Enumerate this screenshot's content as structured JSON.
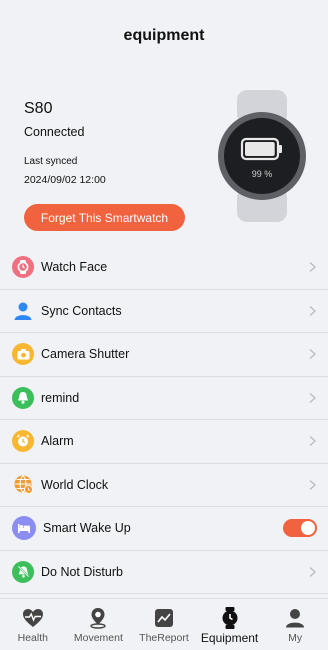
{
  "header": {
    "title": "equipment"
  },
  "device": {
    "name": "S80",
    "status": "Connected",
    "last_synced_label": "Last synced",
    "last_synced_time": "2024/09/02 12:00",
    "battery_text": "99 %",
    "battery_level": 0.99,
    "forget_label": "Forget This Smartwatch"
  },
  "menu": {
    "watch_face": "Watch Face",
    "sync_contacts": "Sync Contacts",
    "camera_shutter": "Camera Shutter",
    "remind": "remind",
    "alarm": "Alarm",
    "world_clock": "World Clock",
    "smart_wake_up": "Smart Wake Up",
    "smart_wake_up_enabled": true,
    "do_not_disturb": "Do Not Disturb"
  },
  "tabs": {
    "health": "Health",
    "movement": "Movement",
    "report": "TheReport",
    "equipment": "Equipment",
    "my": "My",
    "active": "Equipment"
  },
  "colors": {
    "accent": "#f1623f",
    "background": "#f1f2f6",
    "watch_face_icon": "#f26f80",
    "sync_contacts_icon": "#2f86f6",
    "camera_icon": "#f7b733",
    "remind_icon": "#3bbf5a",
    "alarm_icon": "#f7b733",
    "world_clock_icon": "#f39a32",
    "smart_wake_icon": "#8c8df0",
    "dnd_icon": "#3bbf5a"
  }
}
